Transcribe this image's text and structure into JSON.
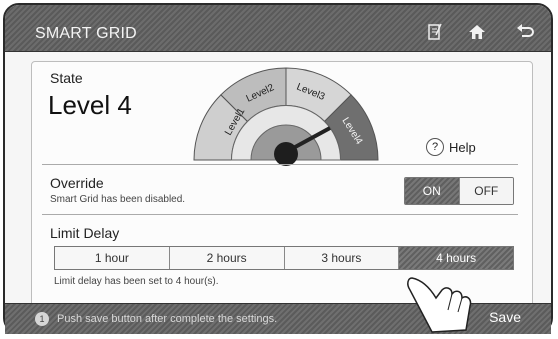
{
  "header": {
    "title": "SMART GRID"
  },
  "icons": {
    "edit": "edit-icon",
    "home": "home-icon",
    "back": "back-icon",
    "help": "help-icon",
    "tip": "info-icon"
  },
  "state": {
    "label": "State",
    "value": "Level 4"
  },
  "gauge": {
    "levels": [
      "Level1",
      "Level2",
      "Level3",
      "Level4"
    ],
    "current_level": 4
  },
  "help": {
    "label": "Help",
    "glyph": "?"
  },
  "override": {
    "label": "Override",
    "note": "Smart Grid has been disabled.",
    "on_label": "ON",
    "off_label": "OFF",
    "selected": "ON"
  },
  "limit_delay": {
    "label": "Limit Delay",
    "options": [
      "1 hour",
      "2 hours",
      "3 hours",
      "4 hours"
    ],
    "selected": "4 hours",
    "note": "Limit delay has been set to 4 hour(s)."
  },
  "footer": {
    "tip_icon": "1",
    "tip": "Push save button after complete the settings.",
    "save_label": "Save"
  },
  "colors": {
    "bar": "#5f5f5f",
    "gauge_dark": "#707070",
    "gauge_light": "#d8d8d8"
  }
}
